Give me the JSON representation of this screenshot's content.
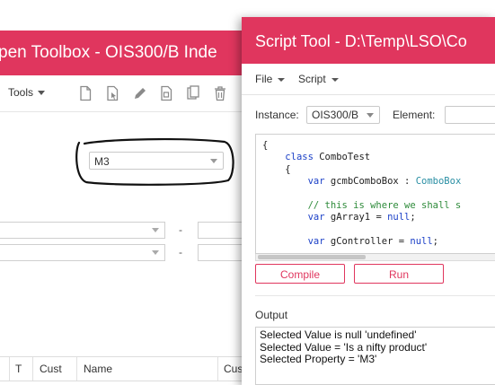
{
  "toolbox": {
    "title": "pen Toolbox - OIS300/B   Inde",
    "tools_label": "Tools",
    "selected_value": "M3",
    "dash": "-",
    "table_headers": [
      "T",
      "Cust",
      "Name",
      "Cus"
    ]
  },
  "script_tool": {
    "title": "Script Tool - D:\\Temp\\LSO\\Co",
    "menu": {
      "file": "File",
      "script": "Script"
    },
    "instance_label": "Instance:",
    "instance_value": "OIS300/B",
    "element_label": "Element:",
    "code_lines": [
      "{",
      "    class ComboTest",
      "    {",
      "        var gcmbComboBox : ComboBox",
      "",
      "        // this is where we shall s",
      "        var gArray1 = null;",
      "",
      "        var gController = null;"
    ],
    "compile_label": "Compile",
    "run_label": "Run",
    "output_label": "Output",
    "output_lines": [
      "Selected Value is null 'undefined'",
      "Selected Value = 'Is a nifty product'",
      "Selected Property = 'M3'"
    ]
  },
  "colors": {
    "accent": "#e0365e",
    "keyword": "#1a3fc7",
    "type": "#2a8fa4",
    "comment": "#2e8b3a"
  },
  "icons": [
    "new-file-icon",
    "open-file-icon",
    "edit-icon",
    "copy-icon",
    "duplicate-icon",
    "delete-icon"
  ]
}
